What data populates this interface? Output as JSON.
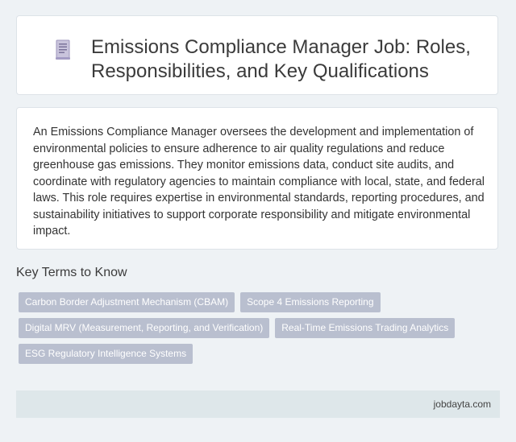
{
  "header": {
    "icon": "document-icon",
    "title": "Emissions Compliance Manager Job: Roles, Responsibilities, and Key Qualifications"
  },
  "summary": {
    "text": "An Emissions Compliance Manager oversees the development and implementation of environmental policies to ensure adherence to air quality regulations and reduce greenhouse gas emissions. They monitor emissions data, conduct site audits, and coordinate with regulatory agencies to maintain compliance with local, state, and federal laws. This role requires expertise in environmental standards, reporting procedures, and sustainability initiatives to support corporate responsibility and mitigate environmental impact."
  },
  "key_terms": {
    "heading": "Key Terms to Know",
    "tags": [
      "Carbon Border Adjustment Mechanism (CBAM)",
      "Scope 4 Emissions Reporting",
      "Digital MRV (Measurement, Reporting, and Verification)",
      "Real-Time Emissions Trading Analytics",
      "ESG Regulatory Intelligence Systems"
    ]
  },
  "footer": {
    "site": "jobdayta.com"
  },
  "colors": {
    "page_bg": "#eef2f5",
    "tag_bg": "#b9bfcf",
    "footer_bg": "#dee7ea"
  }
}
